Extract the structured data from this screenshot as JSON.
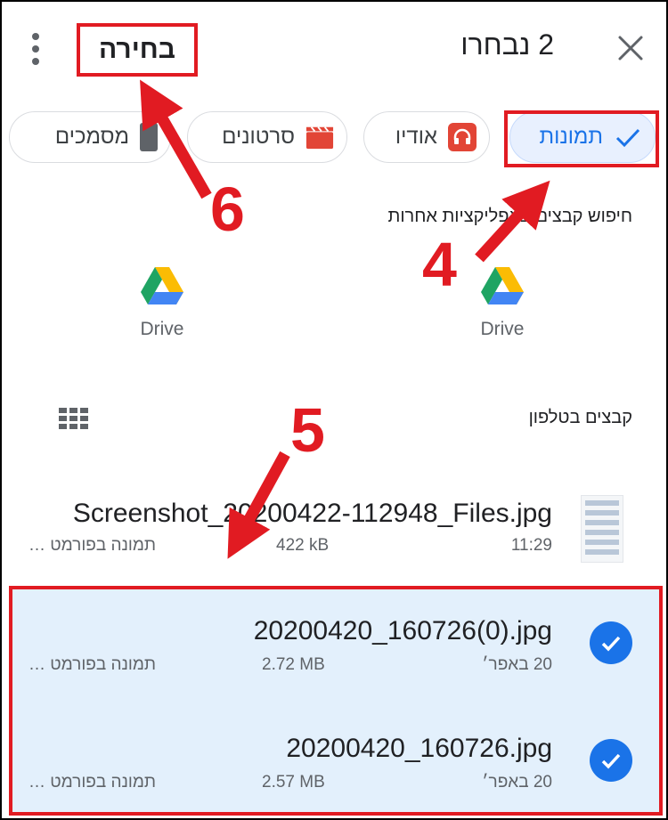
{
  "header": {
    "selected_count": "2 נבחרו",
    "select_button": "בחירה"
  },
  "chips": [
    {
      "label": "תמונות",
      "icon": "check-icon",
      "active": true
    },
    {
      "label": "אודיו",
      "icon": "headphones-icon"
    },
    {
      "label": "סרטונים",
      "icon": "clapperboard-icon"
    },
    {
      "label": "מסמכים",
      "icon": "document-icon"
    }
  ],
  "other_apps": {
    "label": "חיפוש קבצים באפליקציות אחרות",
    "sources": [
      {
        "label": "Drive",
        "icon": "google-drive-icon"
      },
      {
        "label": "Drive",
        "icon": "google-drive-icon"
      }
    ]
  },
  "phone_files": {
    "label": "קבצים בטלפון"
  },
  "files": [
    {
      "name": "Screenshot_20200422-112948_Files.jpg",
      "time": "11:29",
      "size": "422 kB",
      "type": "תמונה בפורמט …",
      "selected": false
    },
    {
      "name": "20200420_160726(0).jpg",
      "time": "20 באפר׳",
      "size": "2.72 MB",
      "type": "תמונה בפורמט …",
      "selected": true
    },
    {
      "name": "20200420_160726.jpg",
      "time": "20 באפר׳",
      "size": "2.57 MB",
      "type": "תמונה בפורמט …",
      "selected": true
    }
  ],
  "annotations": [
    "4",
    "5",
    "6"
  ],
  "colors": {
    "accent": "#1a73e8",
    "annotation": "#e11b22",
    "selected_row": "#e3f0fc"
  }
}
